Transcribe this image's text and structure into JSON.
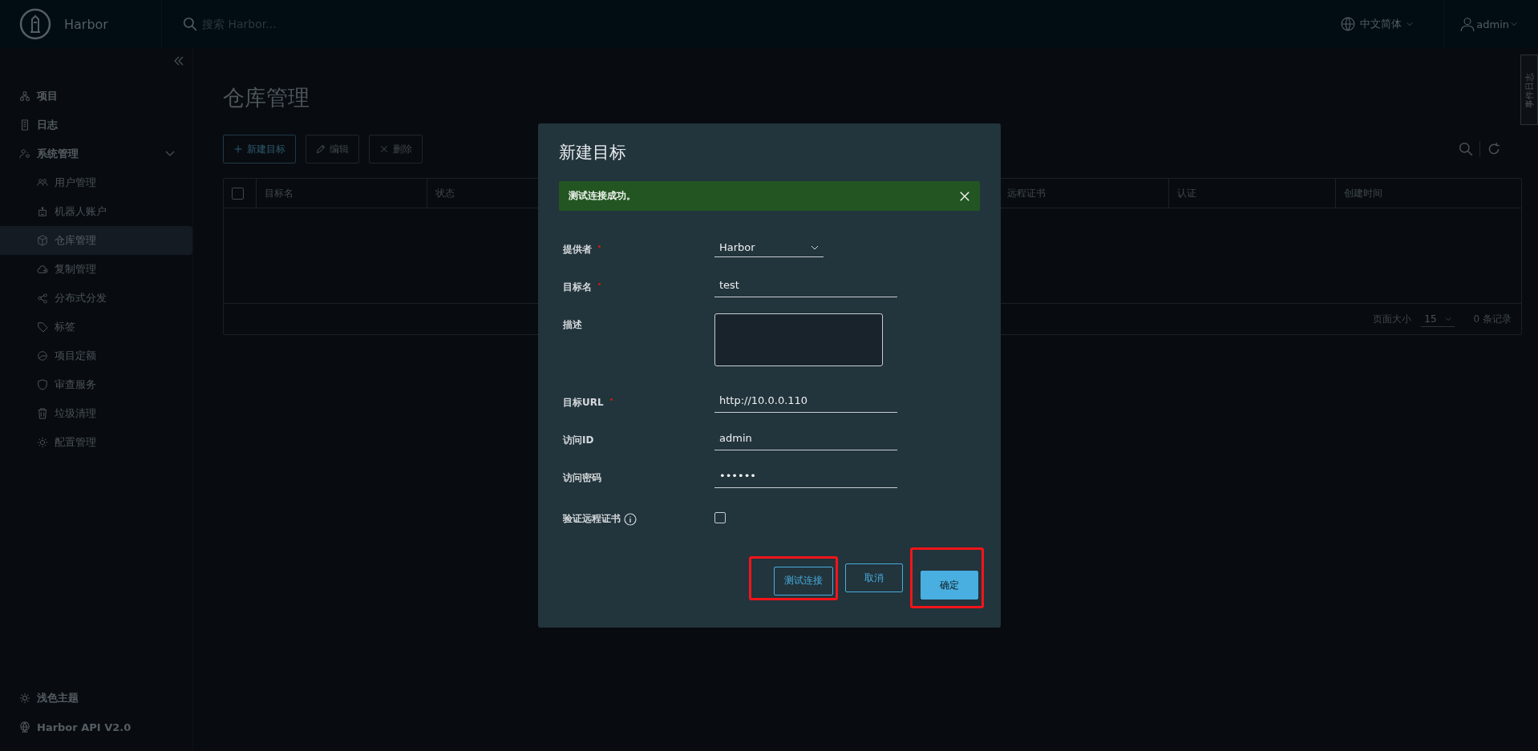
{
  "header": {
    "brand": "Harbor",
    "search": {
      "placeholder": "搜索 Harbor..."
    },
    "language": "中文简体",
    "user": "admin"
  },
  "sidebar": {
    "items": [
      {
        "label": "项目",
        "selected": false
      },
      {
        "label": "日志",
        "selected": false
      },
      {
        "label": "系统管理",
        "selected": false,
        "expanded": true,
        "children": [
          {
            "label": "用户管理",
            "selected": false
          },
          {
            "label": "机器人账户",
            "selected": false
          },
          {
            "label": "仓库管理",
            "selected": true
          },
          {
            "label": "复制管理",
            "selected": false
          },
          {
            "label": "分布式分发",
            "selected": false
          },
          {
            "label": "标签",
            "selected": false
          },
          {
            "label": "项目定额",
            "selected": false
          },
          {
            "label": "审查服务",
            "selected": false
          },
          {
            "label": "垃圾清理",
            "selected": false
          },
          {
            "label": "配置管理",
            "selected": false
          }
        ]
      }
    ],
    "footer_items": [
      {
        "label": "浅色主题"
      },
      {
        "label": "Harbor API V2.0"
      }
    ]
  },
  "side_tab": "事件日志",
  "page": {
    "title": "仓库管理",
    "toolbar": [
      {
        "label": "新建目标",
        "disabled": false
      },
      {
        "label": "编辑",
        "disabled": true
      },
      {
        "label": "删除",
        "disabled": true
      }
    ],
    "table": {
      "select_all_checked": false,
      "columns": [
        "目标名",
        "状态",
        "远程证书",
        "认证",
        "创建时间"
      ],
      "footer": {
        "page_size_label": "页面大小",
        "page_size": "15",
        "count": "0 条记录"
      }
    }
  },
  "dialog": {
    "title": "新建目标",
    "alert": "测试连接成功。",
    "fields": [
      {
        "kind": "select",
        "label": "提供者",
        "required": true,
        "value": "Harbor"
      },
      {
        "kind": "text",
        "label": "目标名",
        "required": true,
        "value": "test"
      },
      {
        "kind": "textarea",
        "label": "描述",
        "required": false
      },
      {
        "kind": "text",
        "label": "目标URL",
        "required": true,
        "value": "http://10.0.0.110"
      },
      {
        "kind": "text",
        "label": "访问ID",
        "required": false,
        "value": "admin"
      },
      {
        "kind": "text",
        "label": "访问密码",
        "required": false,
        "value": "••••••"
      },
      {
        "kind": "checkbox",
        "label": "验证远程证书",
        "required": false,
        "info": true,
        "checked": false
      }
    ],
    "buttons": [
      {
        "label": "测试连接",
        "kind": "outline",
        "highlighted": true
      },
      {
        "label": "取消",
        "kind": "outline",
        "highlighted": false
      },
      {
        "label": "确定",
        "kind": "primary",
        "highlighted": true
      }
    ]
  }
}
